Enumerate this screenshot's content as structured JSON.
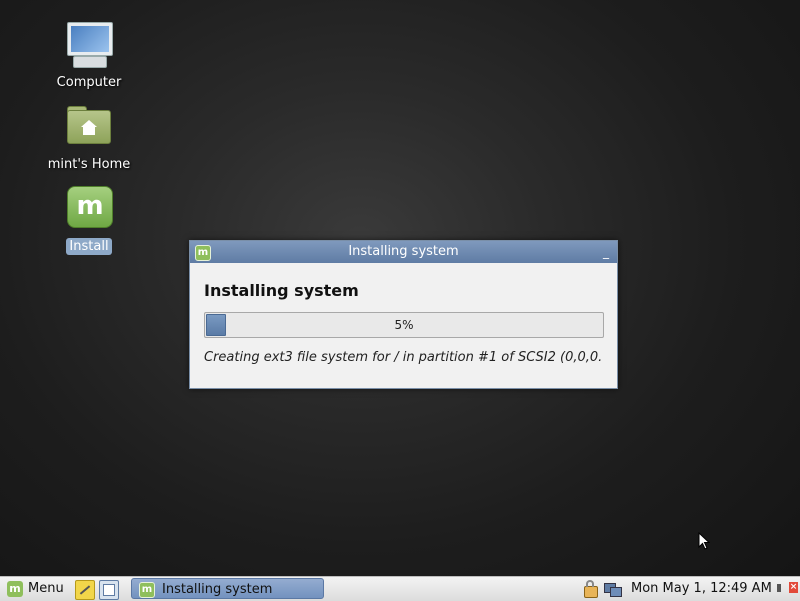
{
  "desktop": {
    "icons": [
      {
        "label": "Computer",
        "icon": "computer-icon"
      },
      {
        "label": "mint's Home",
        "icon": "home-folder-icon"
      },
      {
        "label": "Install",
        "icon": "mint-logo-icon"
      }
    ]
  },
  "dialog": {
    "title": "Installing system",
    "heading": "Installing system",
    "progress_fraction": 0.05,
    "progress_label": "5%",
    "status_text": "Creating ext3 file system for / in partition #1 of SCSI2 (0,0,0...",
    "title_icon_glyph": "m",
    "minimize_glyph": "_"
  },
  "taskbar": {
    "menu_label": "Menu",
    "menu_icon_glyph": "m",
    "task_label": "Installing system",
    "task_icon_glyph": "m",
    "clock": "Mon May  1, 12:49 AM",
    "close_glyph": "×"
  },
  "colors": {
    "titlebar": "#6f8bb2",
    "mint_green": "#8fbf5c",
    "progress_fill": "#5a7ba6"
  }
}
